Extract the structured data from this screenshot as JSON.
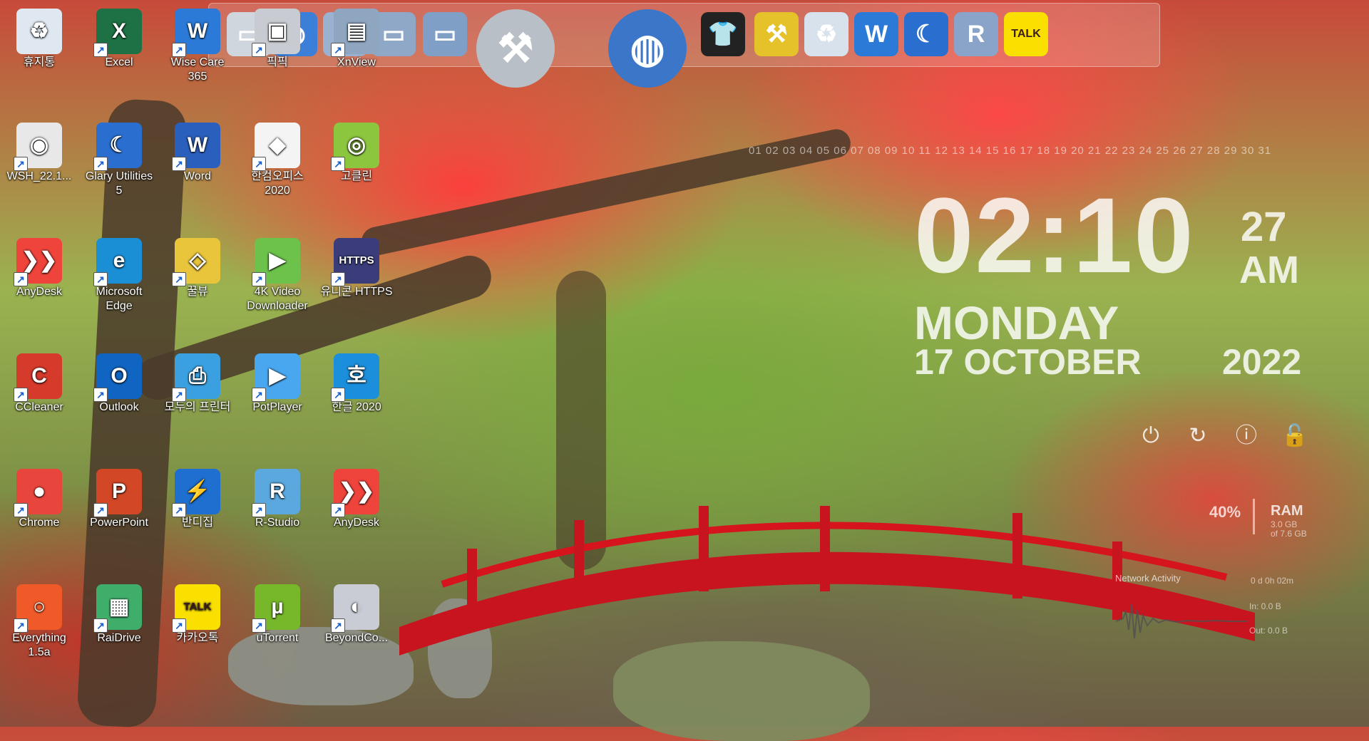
{
  "desktop_icons": [
    {
      "label": "휴지통",
      "glyph": "♻",
      "color": "#dfe8f0",
      "icon": "recycle-bin-icon"
    },
    {
      "label": "Excel",
      "glyph": "X",
      "color": "#1e7145",
      "icon": "excel-icon"
    },
    {
      "label": "Wise Care 365",
      "glyph": "W",
      "color": "#2b7ad8",
      "icon": "wise-care-icon"
    },
    {
      "label": "픽픽",
      "glyph": "▣",
      "color": "#c8ccd2",
      "icon": "picpick-icon"
    },
    {
      "label": "XnView",
      "glyph": "▤",
      "color": "#8fa6c0",
      "icon": "xnview-icon"
    },
    {
      "label": "WSH_22.1...",
      "glyph": "◉",
      "color": "#e8e8e8",
      "icon": "file-icon"
    },
    {
      "label": "Glary Utilities 5",
      "glyph": "☾",
      "color": "#2a6fd0",
      "icon": "glary-icon"
    },
    {
      "label": "Word",
      "glyph": "W",
      "color": "#2b5fbe",
      "icon": "word-icon"
    },
    {
      "label": "한컴오피스 2020",
      "glyph": "◆",
      "color": "#f4f4f4",
      "icon": "hancom-office-icon"
    },
    {
      "label": "고클린",
      "glyph": "◎",
      "color": "#8cc63f",
      "icon": "goclean-icon"
    },
    {
      "label": "AnyDesk",
      "glyph": "❯❯",
      "color": "#ef443b",
      "icon": "anydesk-icon"
    },
    {
      "label": "Microsoft Edge",
      "glyph": "e",
      "color": "#1b8fd6",
      "icon": "edge-icon"
    },
    {
      "label": "꿀뷰",
      "glyph": "◇",
      "color": "#e9c53b",
      "icon": "honeyview-icon"
    },
    {
      "label": "4K Video Downloader",
      "glyph": "▶",
      "color": "#6cc24a",
      "icon": "video-downloader-icon"
    },
    {
      "label": "유니콘 HTTPS",
      "glyph": "HTTPS",
      "color": "#3a3d7a",
      "icon": "unicorn-https-icon"
    },
    {
      "label": "CCleaner",
      "glyph": "C",
      "color": "#d63a2b",
      "icon": "ccleaner-icon"
    },
    {
      "label": "Outlook",
      "glyph": "O",
      "color": "#1064c2",
      "icon": "outlook-icon"
    },
    {
      "label": "모두의 프린터",
      "glyph": "⎙",
      "color": "#3aa0e0",
      "icon": "printer-icon"
    },
    {
      "label": "PotPlayer",
      "glyph": "▶",
      "color": "#49a7f0",
      "icon": "potplayer-icon"
    },
    {
      "label": "한글 2020",
      "glyph": "호",
      "color": "#1b8fdc",
      "icon": "hangul-icon"
    },
    {
      "label": "Chrome",
      "glyph": "●",
      "color": "#e8453c",
      "icon": "chrome-icon"
    },
    {
      "label": "PowerPoint",
      "glyph": "P",
      "color": "#d24726",
      "icon": "powerpoint-icon"
    },
    {
      "label": "반디집",
      "glyph": "⚡",
      "color": "#1f6fd0",
      "icon": "bandizip-icon"
    },
    {
      "label": "R-Studio",
      "glyph": "R",
      "color": "#5aa8de",
      "icon": "r-studio-icon"
    },
    {
      "label": "AnyDesk",
      "glyph": "❯❯",
      "color": "#ef443b",
      "icon": "anydesk-icon"
    },
    {
      "label": "Everything 1.5a",
      "glyph": "○",
      "color": "#f05a28",
      "icon": "everything-icon"
    },
    {
      "label": "RaiDrive",
      "glyph": "▦",
      "color": "#3fae6b",
      "icon": "raidrive-icon"
    },
    {
      "label": "카카오톡",
      "glyph": "TALK",
      "color": "#f9e000",
      "icon": "kakaotalk-icon"
    },
    {
      "label": "uTorrent",
      "glyph": "µ",
      "color": "#76b82a",
      "icon": "utorrent-icon"
    },
    {
      "label": "BeyondCo...",
      "glyph": "◐",
      "color": "#c9ccd4",
      "icon": "beyond-compare-icon"
    }
  ],
  "dock": {
    "items": [
      {
        "icon": "pc-icon",
        "glyph": "▭",
        "color": "#cfd6de"
      },
      {
        "icon": "globe-icon",
        "glyph": "◍",
        "color": "#3c7fd8"
      },
      {
        "icon": "folder-icon",
        "glyph": "▭",
        "color": "#9ab1cf"
      },
      {
        "icon": "folder-icon",
        "glyph": "▭",
        "color": "#8fa8c8"
      },
      {
        "icon": "folder-icon",
        "glyph": "▭",
        "color": "#7f9fc6"
      },
      {
        "icon": "tools-icon",
        "glyph": "⚒",
        "color": "#b9bfc6"
      },
      {
        "icon": "network-globe-icon",
        "glyph": "◍",
        "color": "#3b76c8"
      },
      {
        "icon": "tshirt-icon",
        "glyph": "👕",
        "color": "#222222"
      },
      {
        "icon": "tools-icon",
        "glyph": "⚒",
        "color": "#e5c22a"
      },
      {
        "icon": "recycle-bin-icon",
        "glyph": "♻",
        "color": "#d8e2ec"
      },
      {
        "icon": "wise-care-icon",
        "glyph": "W",
        "color": "#2b7ad8"
      },
      {
        "icon": "glary-icon",
        "glyph": "☾",
        "color": "#2a6fd0"
      },
      {
        "icon": "r-studio-icon",
        "glyph": "R",
        "color": "#8aa3c8"
      },
      {
        "icon": "kakaotalk-icon",
        "glyph": "TALK",
        "color": "#f9e000"
      }
    ]
  },
  "calendar": {
    "row": "01 02 03 04 05 06 07 08 09 10 11 12 13 14 15 16 17 18 19 20 21 22 23 24 25 26 27 28 29 30 31"
  },
  "clock": {
    "time": "02:10",
    "seconds": "27",
    "ampm": "AM",
    "day": "MONDAY",
    "date": "17 OCTOBER",
    "year": "2022"
  },
  "power_controls": [
    {
      "icon": "power-icon",
      "glyph": "⏻"
    },
    {
      "icon": "restart-icon",
      "glyph": "↻"
    },
    {
      "icon": "info-icon",
      "glyph": "ⓘ"
    },
    {
      "icon": "lock-icon",
      "glyph": "🔓"
    }
  ],
  "ram": {
    "percent": "40%",
    "title": "RAM",
    "used": "3.0 GB",
    "total": "of 7.6 GB"
  },
  "network": {
    "title": "Network Activity",
    "uptime": "0 d 0h 02m",
    "in": "In: 0.0 B",
    "out": "Out: 0.0 B"
  }
}
